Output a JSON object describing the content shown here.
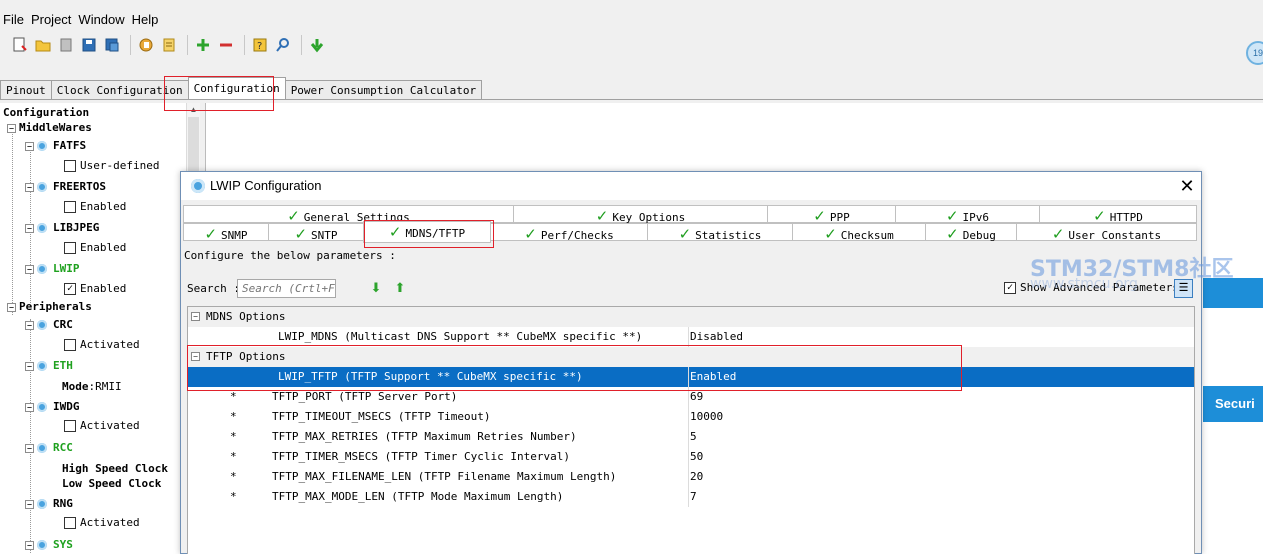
{
  "menu": [
    "File",
    "Project",
    "Window",
    "Help"
  ],
  "toolbar_icons": [
    "new-project-icon",
    "open-icon",
    "close-icon",
    "save-icon",
    "save-as-icon",
    "generate-report-icon",
    "generate-code-icon",
    "add-icon",
    "remove-icon",
    "info-icon",
    "search-parameters-icon",
    "download-icon"
  ],
  "main_tabs": [
    "Pinout",
    "Clock Configuration",
    "Configuration",
    "Power Consumption Calculator"
  ],
  "tree": {
    "root": "Configuration",
    "middlewares": "MiddleWares",
    "fatfs": "FATFS",
    "fatfs_opt": "User-defined",
    "freertos": "FREERTOS",
    "freertos_opt": "Enabled",
    "libjpeg": "LIBJPEG",
    "libjpeg_opt": "Enabled",
    "lwip": "LWIP",
    "lwip_opt": "Enabled",
    "peripherals": "Peripherals",
    "crc": "CRC",
    "crc_opt": "Activated",
    "eth": "ETH",
    "eth_mode": "Mode",
    "eth_mode_val": ":RMII",
    "iwdg": "IWDG",
    "iwdg_opt": "Activated",
    "rcc": "RCC",
    "rcc_high": "High Speed Clock",
    "rcc_low": "Low Speed Clock",
    "rng": "RNG",
    "rng_opt": "Activated",
    "sys": "SYS"
  },
  "security_label": "Securi",
  "dialog": {
    "title": "LWIP Configuration",
    "tabs_top": [
      "General Settings",
      "Key Options",
      "PPP",
      "IPv6",
      "HTTPD"
    ],
    "tabs_bottom": [
      "SNMP",
      "SNTP",
      "MDNS/TFTP",
      "Perf/Checks",
      "Statistics",
      "Checksum",
      "Debug",
      "User Constants"
    ],
    "description": "Configure the below parameters :",
    "search_label": "Search :",
    "search_placeholder": "Search (Crtl+F)",
    "show_advanced": "Show Advanced Parameters",
    "groups": [
      {
        "name": "MDNS Options",
        "rows": [
          {
            "marker": "",
            "param": "LWIP_MDNS (Multicast DNS Support ** CubeMX specific **)",
            "value": "Disabled"
          }
        ]
      },
      {
        "name": "TFTP Options",
        "rows": [
          {
            "marker": "",
            "param": "LWIP_TFTP (TFTP Support ** CubeMX specific **)",
            "value": "Enabled"
          },
          {
            "marker": "*",
            "param": "TFTP_PORT (TFTP Server Port)",
            "value": "69"
          },
          {
            "marker": "*",
            "param": "TFTP_TIMEOUT_MSECS (TFTP Timeout)",
            "value": "10000"
          },
          {
            "marker": "*",
            "param": "TFTP_MAX_RETRIES (TFTP Maximum Retries Number)",
            "value": "5"
          },
          {
            "marker": "*",
            "param": "TFTP_TIMER_MSECS (TFTP Timer Cyclic Interval)",
            "value": "50"
          },
          {
            "marker": "*",
            "param": "TFTP_MAX_FILENAME_LEN (TFTP Filename Maximum Length)",
            "value": "20"
          },
          {
            "marker": "*",
            "param": "TFTP_MAX_MODE_LEN (TFTP Mode Maximum Length)",
            "value": "7"
          }
        ]
      }
    ]
  },
  "watermark": "STM32/STM8社区",
  "watermark_sub": "www.stmcu.org",
  "colors": {
    "selection": "#0a6dc4",
    "accent": "#1d8ed8",
    "check": "#1f9e1f",
    "highlight_box": "#e0202a"
  }
}
